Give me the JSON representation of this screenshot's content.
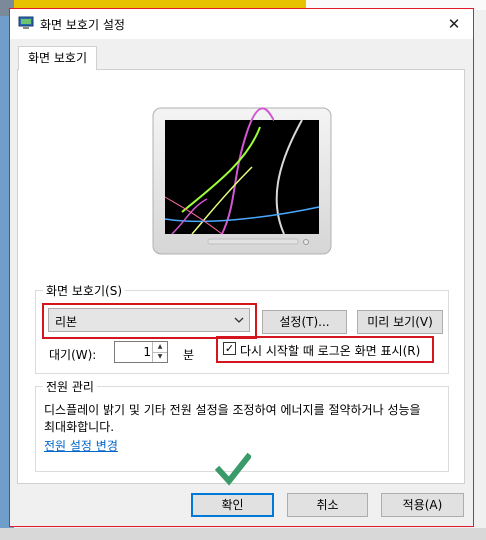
{
  "window": {
    "title": "화면 보호기 설정",
    "close_glyph": "✕"
  },
  "tabs": [
    {
      "label": "화면 보호기"
    }
  ],
  "screensaver": {
    "group_label": "화면 보호기(S)",
    "selected": "리본",
    "settings_button": "설정(T)...",
    "preview_button": "미리 보기(V)",
    "wait_label": "대기(W):",
    "wait_value": "1",
    "wait_unit": "분",
    "resume_checkbox_label": "다시 시작할 때 로그온 화면 표시(R)",
    "resume_checked": true
  },
  "power": {
    "group_label": "전원 관리",
    "description": "디스플레이 밝기 및 기타 전원 설정을 조정하여 에너지를 절약하거나 성능을 최대화합니다.",
    "link": "전원 설정 변경"
  },
  "buttons": {
    "ok": "확인",
    "cancel": "취소",
    "apply": "적용(A)"
  },
  "colors": {
    "highlight_border": "#d4141e",
    "accent": "#0078d7",
    "link": "#0066cc",
    "checkmark": "#3a9a6a"
  }
}
